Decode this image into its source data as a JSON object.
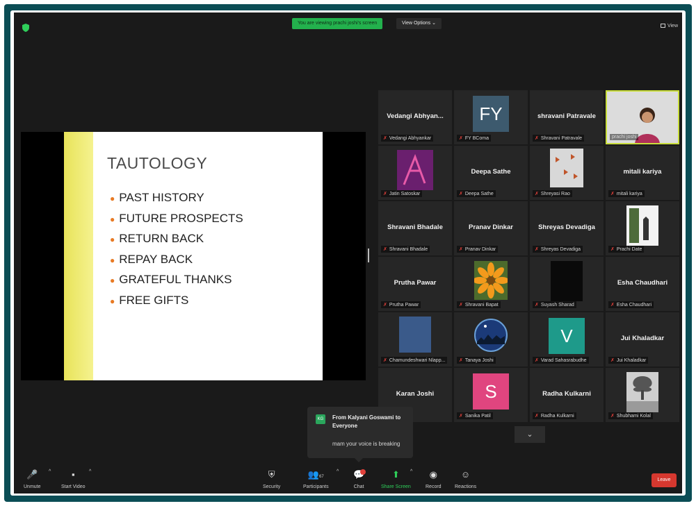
{
  "topbar": {
    "viewing_banner": "You are viewing prachi joshi's screen",
    "view_options": "View Options",
    "view_label": "View"
  },
  "slide": {
    "title": "TAUTOLOGY",
    "bullets": [
      "PAST HISTORY",
      "FUTURE PROSPECTS",
      "RETURN BACK",
      "REPAY BACK",
      "GRATEFUL THANKS",
      "FREE GIFTS"
    ],
    "accent_color": "#e87a24"
  },
  "gallery": {
    "tiles": [
      {
        "name": "Vedangi  Abhyan...",
        "label": "Vedangi Abhyankar"
      },
      {
        "avatar": "FY",
        "label": "FY BComa"
      },
      {
        "name": "shravani Patravale",
        "label": "Shravani Patravale"
      },
      {
        "label": "prachi joshi"
      },
      {
        "label": "Jatin Satoskar"
      },
      {
        "name": "Deepa Sathe",
        "label": "Deepa Sathe"
      },
      {
        "label": "Shreyasi Rao"
      },
      {
        "name": "mitali kariya",
        "label": "mitali kariya"
      },
      {
        "name": "Shravani Bhadale",
        "label": "Shravani Bhadale"
      },
      {
        "name": "Pranav Dinkar",
        "label": "Pranav Dinkar"
      },
      {
        "name": "Shreyas Devadiga",
        "label": "Shreyas Devadiga"
      },
      {
        "label": "Prachi Date"
      },
      {
        "name": "Prutha Pawar",
        "label": "Prutha Pawar"
      },
      {
        "label": "Shravani Bapat"
      },
      {
        "label": "Suyash Sharad"
      },
      {
        "name": "Esha Chaudhari",
        "label": "Esha Chaudhari"
      },
      {
        "label": "Chamundeshwari Nlapp..."
      },
      {
        "label": "Tanaya Joshi"
      },
      {
        "avatar": "V",
        "label": "Varad Sahasrabudhe"
      },
      {
        "name": "Jui Khaladkar",
        "label": "Jui Khaladkar"
      },
      {
        "name": "Karan Joshi",
        "label": ""
      },
      {
        "avatar": "S",
        "label": "Sanika Patil"
      },
      {
        "name": "Radha Kulkarni",
        "label": "Radha Kulkarni"
      },
      {
        "label": "Shubhami Kolal"
      }
    ]
  },
  "chat_popup": {
    "initials": "KG",
    "from": "From Kalyani Goswami to Everyone",
    "message": "mam your voice is breaking"
  },
  "toolbar": {
    "unmute": "Unmute",
    "start_video": "Start Video",
    "security": "Security",
    "participants": "Participants",
    "participants_count": "67",
    "chat": "Chat",
    "share_screen": "Share Screen",
    "record": "Record",
    "reactions": "Reactions",
    "leave": "Leave"
  },
  "colors": {
    "banner_green": "#23b14d",
    "leave_red": "#d6382f",
    "active_speaker": "#c9de3b"
  }
}
